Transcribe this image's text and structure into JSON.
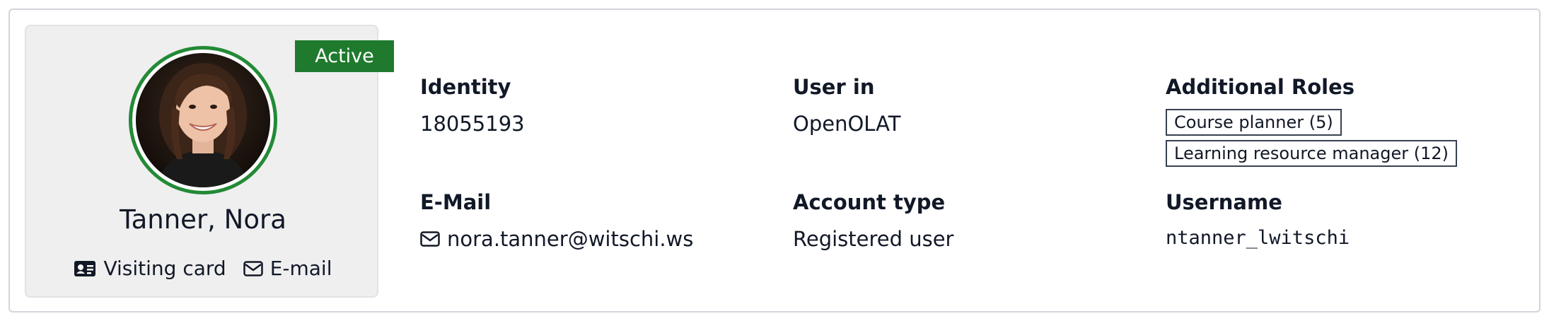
{
  "profile": {
    "status": "Active",
    "name": "Tanner, Nora",
    "visiting_card_label": "Visiting card",
    "email_link_label": "E-mail"
  },
  "fields": {
    "identity": {
      "label": "Identity",
      "value": "18055193"
    },
    "user_in": {
      "label": "User in",
      "value": "OpenOLAT"
    },
    "additional_roles": {
      "label": "Additional Roles",
      "roles": [
        "Course planner (5)",
        "Learning resource manager (12)"
      ]
    },
    "email": {
      "label": "E-Mail",
      "value": "nora.tanner@witschi.ws"
    },
    "account_type": {
      "label": "Account type",
      "value": "Registered user"
    },
    "username": {
      "label": "Username",
      "value": "ntanner_lwitschi"
    }
  },
  "colors": {
    "status_active": "#1f7a2e",
    "avatar_ring": "#238a36",
    "card_bg": "#efefef"
  },
  "icons": {
    "visiting_card": "id-card-icon",
    "email_link": "envelope-icon",
    "email_field": "envelope-icon"
  }
}
